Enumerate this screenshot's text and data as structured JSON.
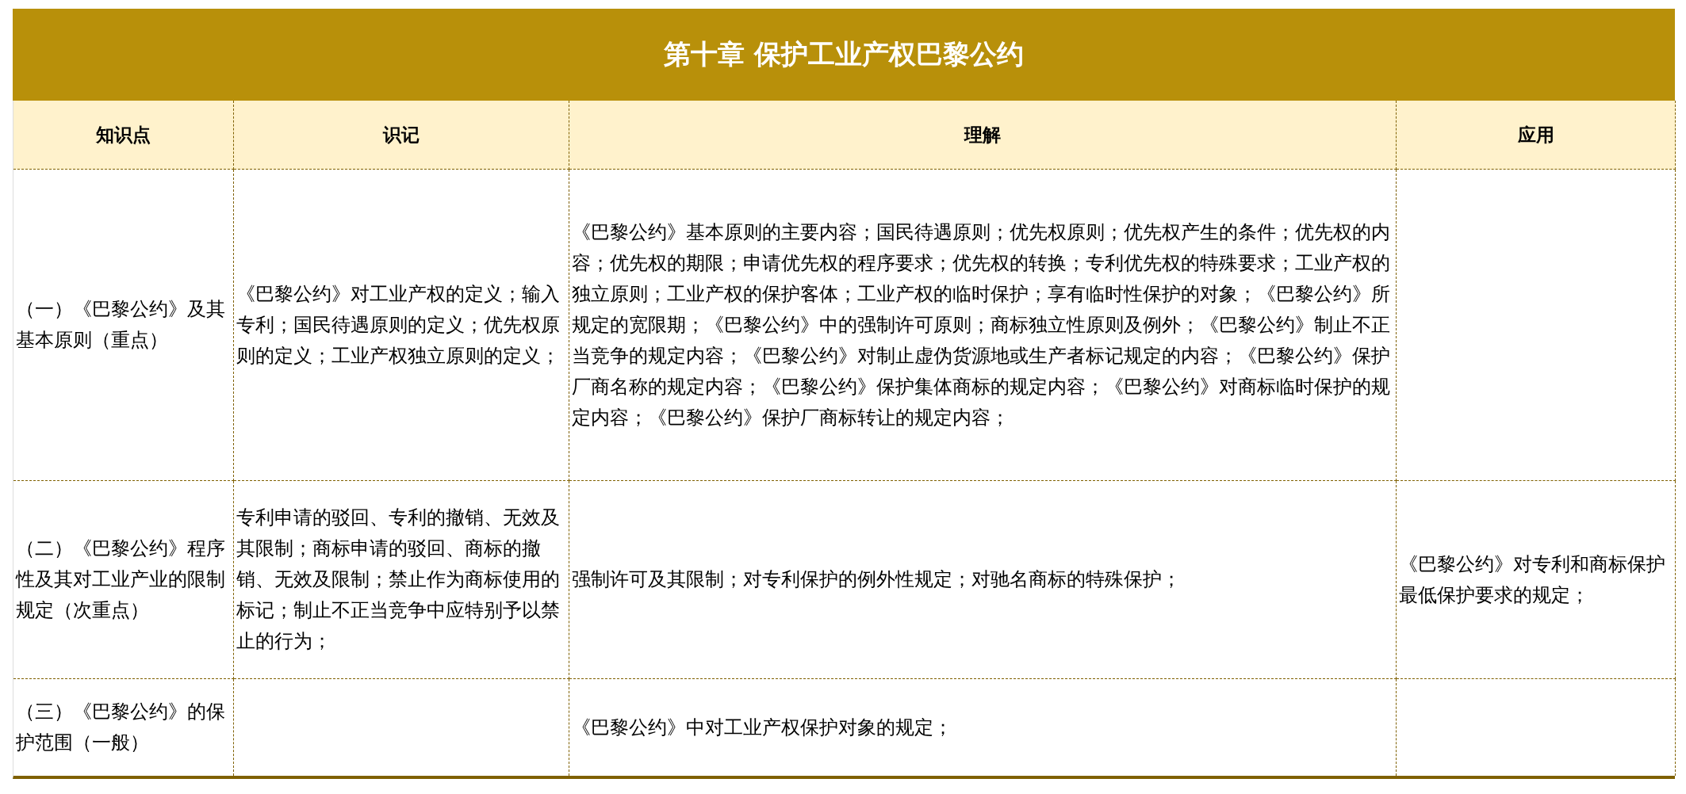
{
  "title": "第十章 保护工业产权巴黎公约",
  "columns": [
    "知识点",
    "识记",
    "理解",
    "应用"
  ],
  "rows": [
    {
      "cells": [
        "（一）《巴黎公约》及其基本原则（重点）",
        "《巴黎公约》对工业产权的定义；输入专利；国民待遇原则的定义；优先权原则的定义；工业产权独立原则的定义；",
        "《巴黎公约》基本原则的主要内容；国民待遇原则；优先权原则；优先权产生的条件；优先权的内容；优先权的期限；申请优先权的程序要求；优先权的转换；专利优先权的特殊要求；工业产权的独立原则；工业产权的保护客体；工业产权的临时保护；享有临时性保护的对象；《巴黎公约》所规定的宽限期；《巴黎公约》中的强制许可原则；商标独立性原则及例外；《巴黎公约》制止不正当竞争的规定内容；《巴黎公约》对制止虚伪货源地或生产者标记规定的内容；《巴黎公约》保护厂商名称的规定内容；《巴黎公约》保护集体商标的规定内容；《巴黎公约》对商标临时保护的规定内容；《巴黎公约》保护厂商标转让的规定内容；",
        null
      ]
    },
    {
      "cells": [
        "（二）《巴黎公约》程序性及其对工业产业的限制规定（次重点）",
        "专利申请的驳回、专利的撤销、无效及其限制；商标申请的驳回、商标的撤销、无效及限制；禁止作为商标使用的标记；制止不正当竞争中应特别予以禁止的行为；",
        "强制许可及其限制；对专利保护的例外性规定；对驰名商标的特殊保护；",
        "《巴黎公约》对专利和商标保护最低保护要求的规定；"
      ]
    },
    {
      "cells": [
        "（三）《巴黎公约》的保护范围（一般）",
        null,
        "《巴黎公约》中对工业产权保护对象的规定；",
        null
      ]
    }
  ]
}
